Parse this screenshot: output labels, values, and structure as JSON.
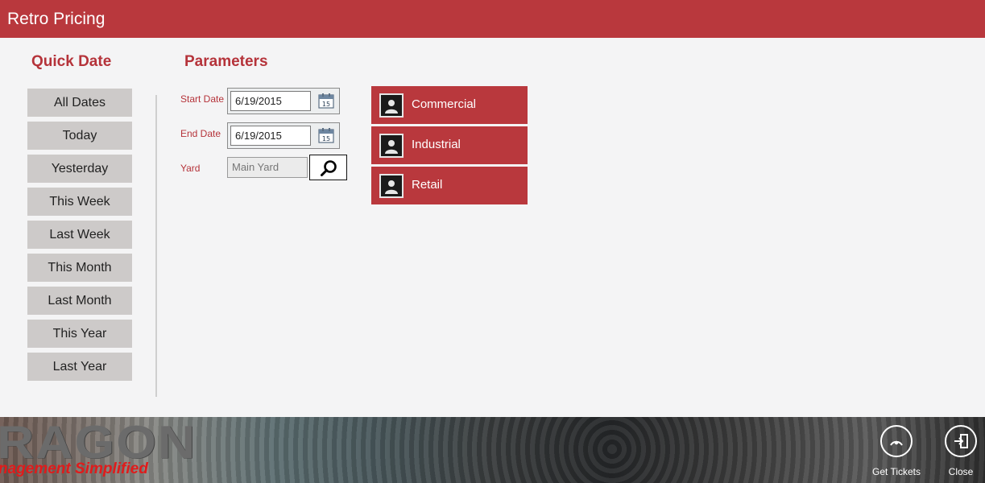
{
  "window": {
    "title": "Retro Pricing"
  },
  "quick_date": {
    "heading": "Quick Date",
    "buttons": [
      "All Dates",
      "Today",
      "Yesterday",
      "This Week",
      "Last Week",
      "This Month",
      "Last Month",
      "This Year",
      "Last Year"
    ]
  },
  "parameters": {
    "heading": "Parameters",
    "start_date_label": "Start Date",
    "start_date_value": "6/19/2015",
    "end_date_label": "End Date",
    "end_date_value": "6/19/2015",
    "yard_label": "Yard",
    "yard_value": "Main Yard"
  },
  "categories": [
    "Commercial",
    "Industrial",
    "Retail"
  ],
  "footer": {
    "logo_text": "RAGON",
    "logo_tagline": "nagement Simplified",
    "actions": {
      "get_tickets": "Get Tickets",
      "close": "Close"
    }
  },
  "colors": {
    "accent": "#b9383d",
    "heading": "#b5333a",
    "quick_button": "#cdcac9"
  },
  "icons": {
    "calendar": "calendar-icon",
    "search": "search-icon",
    "category": "image-placeholder-icon",
    "get_tickets": "get-tickets-icon",
    "close": "exit-icon"
  }
}
